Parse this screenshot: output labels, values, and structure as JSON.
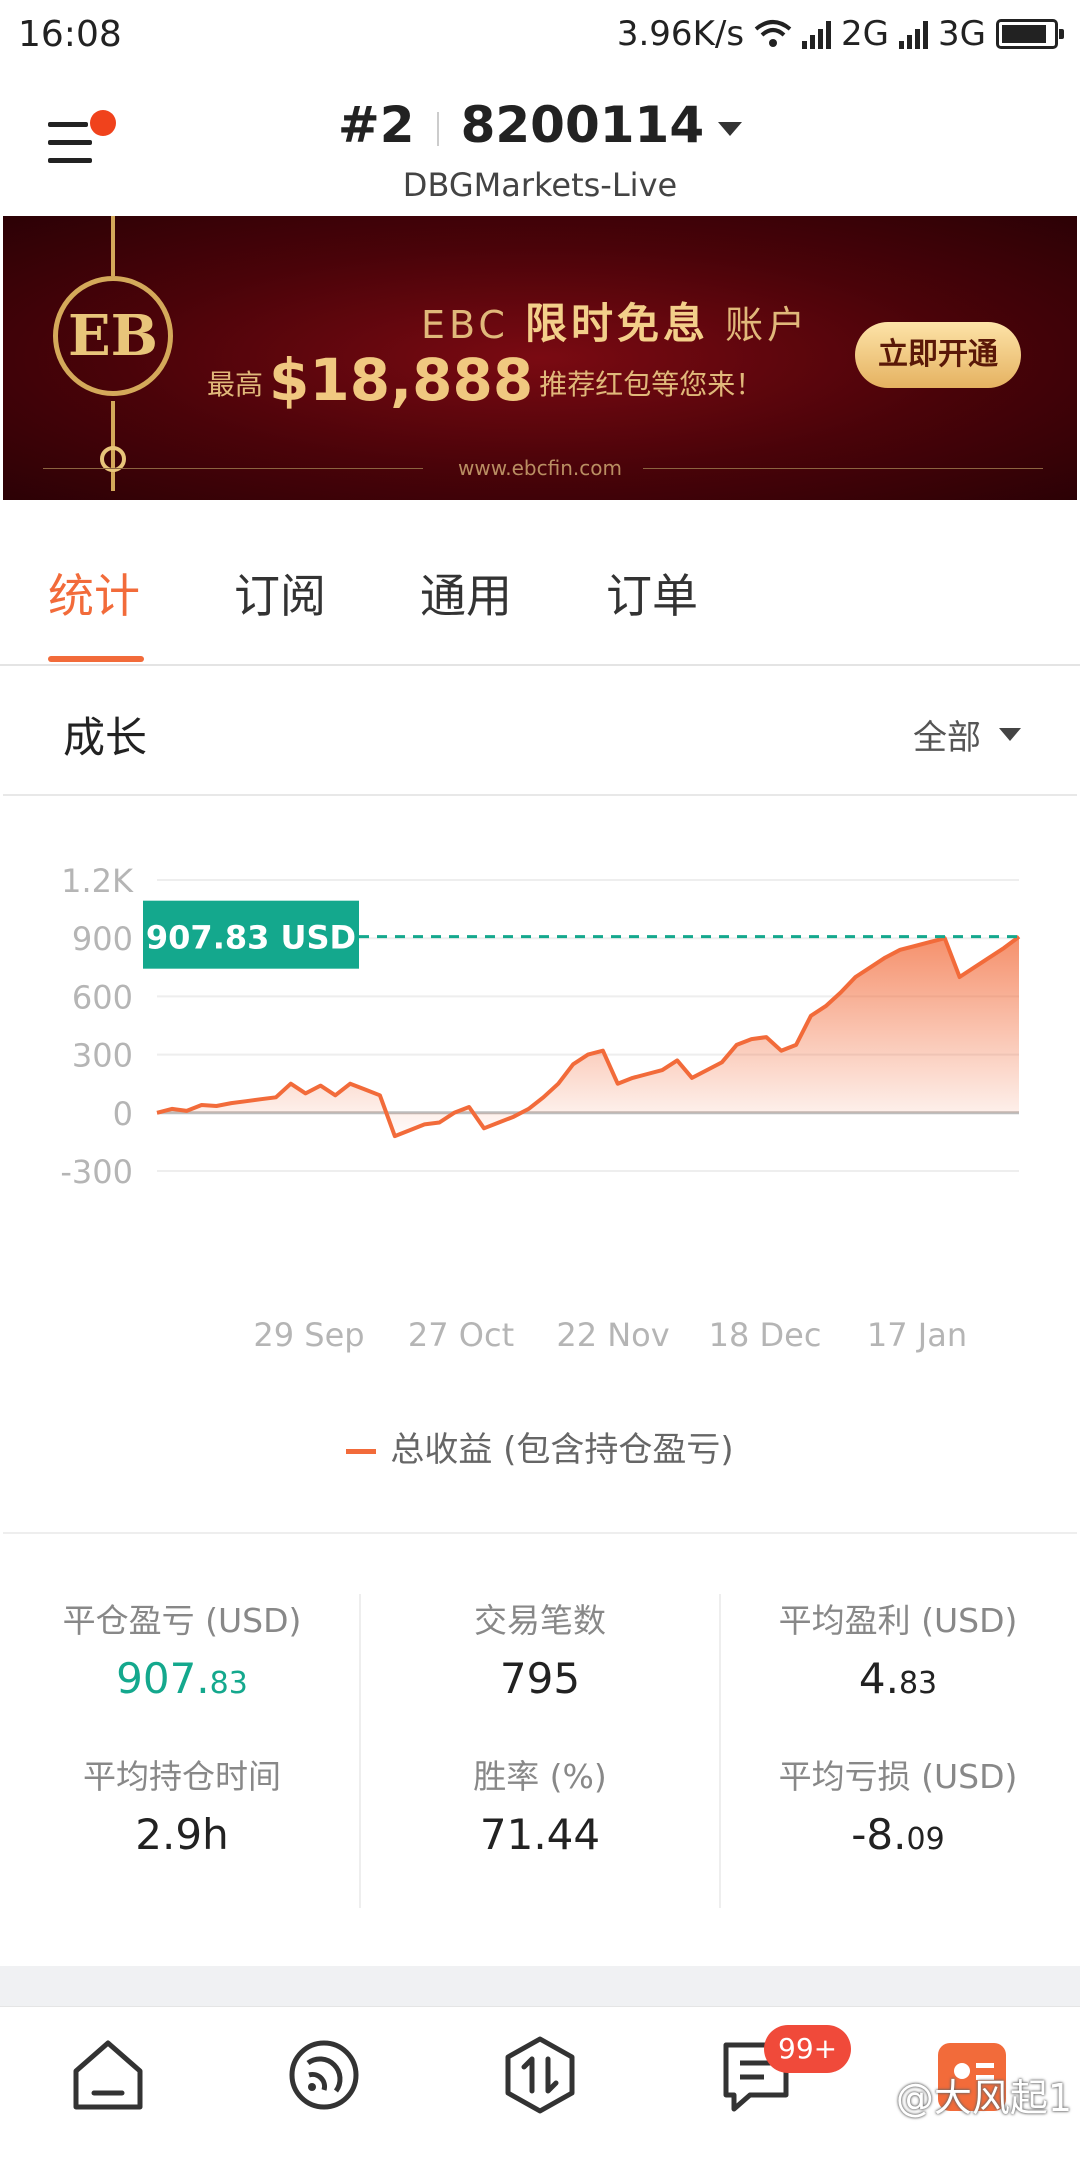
{
  "status_bar": {
    "time": "16:08",
    "speed": "3.96K/s",
    "net1": "2G",
    "net2": "3G"
  },
  "header": {
    "account_index": "#2",
    "account_number": "8200114",
    "server": "DBGMarkets-Live",
    "menu_icon": "hamburger-menu-icon",
    "notification_color": "#f0421c"
  },
  "banner": {
    "brand": "EBC",
    "headline_highlight": "限时免息",
    "headline_suffix": "账户",
    "prefix": "最高",
    "amount": "$18,888",
    "suffix": "推荐红包等您来！",
    "cta": "立即开通",
    "url": "www.ebcfin.com"
  },
  "tabs": [
    {
      "label": "统计",
      "active": true
    },
    {
      "label": "订阅",
      "active": false
    },
    {
      "label": "通用",
      "active": false
    },
    {
      "label": "订单",
      "active": false
    }
  ],
  "section": {
    "title": "成长",
    "filter": "全部"
  },
  "chart_data": {
    "type": "area",
    "y_ticks": [
      "1.2K",
      "900",
      "600",
      "300",
      "0",
      "-300"
    ],
    "ylim": [
      -300,
      1200
    ],
    "x_ticks": [
      "29 Sep",
      "27 Oct",
      "22 Nov",
      "18 Dec",
      "17 Jan"
    ],
    "current_value_label": "907.83 USD",
    "current_value": 907.83,
    "series": [
      {
        "name": "总收益 (包含持仓盈亏)",
        "color": "#f26b3a",
        "values": [
          0,
          20,
          10,
          40,
          35,
          50,
          60,
          70,
          80,
          150,
          100,
          140,
          90,
          150,
          120,
          90,
          -120,
          -90,
          -60,
          -50,
          0,
          30,
          -80,
          -50,
          -20,
          20,
          80,
          150,
          250,
          300,
          320,
          150,
          180,
          200,
          220,
          270,
          180,
          220,
          260,
          350,
          380,
          390,
          320,
          350,
          500,
          550,
          620,
          700,
          750,
          800,
          840,
          860,
          880,
          900,
          700,
          750,
          800,
          850,
          907.83
        ]
      }
    ],
    "grid": true,
    "legend_position": "bottom",
    "colors": {
      "line": "#f26b3a",
      "marker": "#14a88d"
    }
  },
  "stats": [
    {
      "label": "平仓盈亏 (USD)",
      "value_int": "907.",
      "value_dec": "83",
      "highlight": true
    },
    {
      "label": "交易笔数",
      "value_int": "795",
      "value_dec": "",
      "highlight": false
    },
    {
      "label": "平均盈利 (USD)",
      "value_int": "4.",
      "value_dec": "83",
      "highlight": false
    },
    {
      "label": "平均持仓时间",
      "value_int": "2.9h",
      "value_dec": "",
      "highlight": false
    },
    {
      "label": "胜率 (%)",
      "value_int": "71.44",
      "value_dec": "",
      "highlight": false
    },
    {
      "label": "平均亏损 (USD)",
      "value_int": "-8.",
      "value_dec": "09",
      "highlight": false
    }
  ],
  "bottom_nav": {
    "items": [
      "home-icon",
      "signal-icon",
      "trade-icon",
      "messages-icon",
      "profile-icon"
    ],
    "badge": "99+",
    "watermark": "@大风起1"
  }
}
